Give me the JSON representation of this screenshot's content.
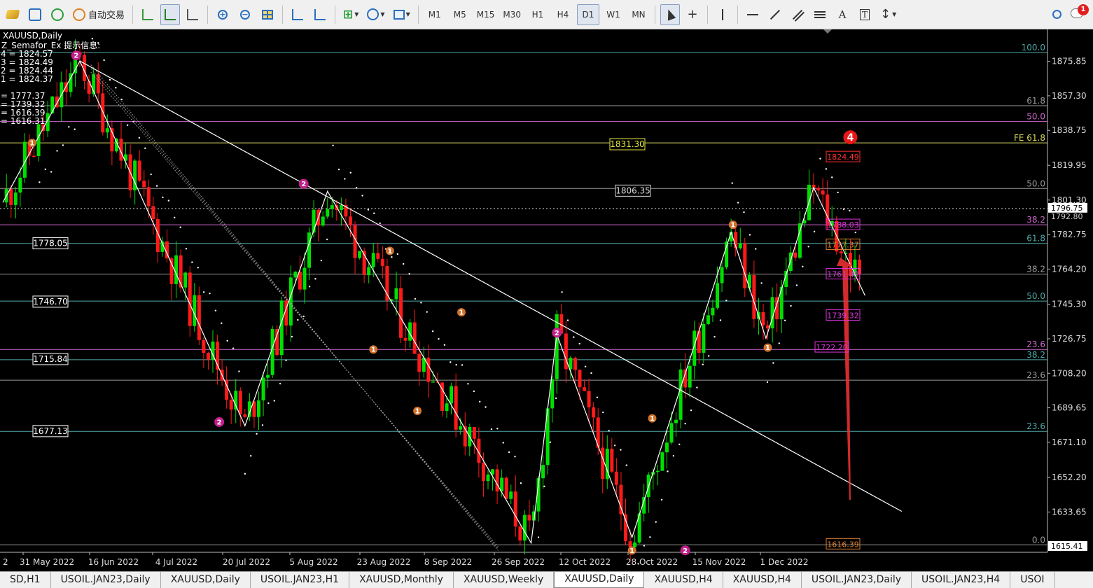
{
  "toolbar": {
    "auto_trading_label": "自动交易",
    "timeframes": [
      "M1",
      "M5",
      "M15",
      "M30",
      "H1",
      "H4",
      "D1",
      "W1",
      "MN"
    ],
    "active_timeframe": "D1",
    "text_tool": "A",
    "notification_count": "1"
  },
  "chart_info": {
    "symbol_period": "XAUUSD,Daily",
    "indicator_header": "Z_Semafor_Ex 提示信息:",
    "indicator_rows": [
      "4 = 1824.57",
      "3 = 1824.49",
      "2 = 1824.44",
      "1 = 1824.37",
      "= 1777.37",
      "= 1739.32",
      "= 1616.39",
      "= 1616.31"
    ]
  },
  "chart_data": {
    "type": "candlestick",
    "symbol": "XAUUSD",
    "period": "Daily",
    "price_axis_ticks": [
      1875.85,
      1857.3,
      1838.75,
      1819.95,
      1801.3,
      1782.75,
      1764.2,
      1745.3,
      1726.75,
      1708.2,
      1689.65,
      1671.1,
      1652.2,
      1633.65,
      1615.41
    ],
    "current_price_labels": [
      "1796.75",
      "1792.80"
    ],
    "bottom_price_label": "1615.41",
    "date_ticks": [
      "2",
      "31 May 2022",
      "16 Jun 2022",
      "4 Jul 2022",
      "20 Jul 2022",
      "5 Aug 2022",
      "23 Aug 2022",
      "8 Sep 2022",
      "26 Sep 2022",
      "12 Oct 2022",
      "28 Oct 2022",
      "15 Nov 2022",
      "1 Dec 2022"
    ],
    "fibo_levels": [
      {
        "label": "100.0",
        "price": 1880.5,
        "color": "#4fa8a8"
      },
      {
        "label": "61.8",
        "price": 1852.0,
        "color": "#9a9a9a"
      },
      {
        "label": "50.0",
        "price": 1843.5,
        "color": "#cc66cc"
      },
      {
        "label": "FE 61.8",
        "price": 1832.0,
        "color": "#d8d860"
      },
      {
        "label": "50.0",
        "price": 1807.5,
        "color": "#9a9a9a"
      },
      {
        "label": "38.2",
        "price": 1788.0,
        "color": "#cc66cc"
      },
      {
        "label": "61.8",
        "price": 1778.0,
        "color": "#4fa8a8"
      },
      {
        "label": "38.2",
        "price": 1761.5,
        "color": "#9a9a9a"
      },
      {
        "label": "50.0",
        "price": 1747.0,
        "color": "#4fa8a8"
      },
      {
        "label": "23.6",
        "price": 1721.0,
        "color": "#cc66cc"
      },
      {
        "label": "38.2",
        "price": 1715.5,
        "color": "#4fa8a8"
      },
      {
        "label": "23.6",
        "price": 1704.5,
        "color": "#9a9a9a"
      },
      {
        "label": "23.6",
        "price": 1677.0,
        "color": "#4fa8a8"
      },
      {
        "label": "0.0",
        "price": 1616.0,
        "color": "#9a9a9a"
      }
    ],
    "left_price_boxes": [
      {
        "text": "1778.05",
        "price": 1778.05
      },
      {
        "text": "1746.70",
        "price": 1746.7
      },
      {
        "text": "1715.84",
        "price": 1715.84
      },
      {
        "text": "1677.13",
        "price": 1677.13
      }
    ],
    "mid_price_boxes": [
      {
        "text": "1831.30",
        "price": 1831.3,
        "color": "#e8e840"
      },
      {
        "text": "1806.35",
        "price": 1806.35,
        "color": "#dddddd"
      }
    ],
    "right_price_boxes": [
      {
        "text": "1824.49",
        "price": 1824.49,
        "color": "#ff3030"
      },
      {
        "text": "1788.03",
        "price": 1788.03,
        "color": "#dd33dd"
      },
      {
        "text": "1777.37",
        "price": 1777.37,
        "color": "#e08030"
      },
      {
        "text": "1761.49",
        "price": 1761.49,
        "color": "#dd33dd"
      },
      {
        "text": "1739.32",
        "price": 1739.32,
        "color": "#dd33dd"
      },
      {
        "text": "1722.20",
        "price": 1722.2,
        "color": "#dd33dd"
      },
      {
        "text": "1616.39",
        "price": 1616.39,
        "color": "#e08030"
      }
    ],
    "semafor_signals": [
      {
        "label": "1",
        "day": 16,
        "price": 1832,
        "type": "orange"
      },
      {
        "label": "2",
        "day": 40,
        "price": 1879,
        "type": "magenta"
      },
      {
        "label": "2",
        "day": 118,
        "price": 1682,
        "type": "magenta"
      },
      {
        "label": "2",
        "day": 164,
        "price": 1810,
        "type": "magenta"
      },
      {
        "label": "1",
        "day": 202,
        "price": 1721,
        "type": "orange"
      },
      {
        "label": "1",
        "day": 211,
        "price": 1774,
        "type": "orange"
      },
      {
        "label": "1",
        "day": 226,
        "price": 1688,
        "type": "orange"
      },
      {
        "label": "1",
        "day": 250,
        "price": 1741,
        "type": "orange"
      },
      {
        "label": "2",
        "day": 302,
        "price": 1730,
        "type": "magenta"
      },
      {
        "label": "1",
        "day": 354,
        "price": 1684,
        "type": "orange"
      },
      {
        "label": "1",
        "day": 343,
        "price": 1613,
        "type": "orange"
      },
      {
        "label": "2",
        "day": 372,
        "price": 1613,
        "type": "magenta"
      },
      {
        "label": "1",
        "day": 398,
        "price": 1788,
        "type": "orange"
      },
      {
        "label": "1",
        "day": 417,
        "price": 1722,
        "type": "orange"
      },
      {
        "label": "4",
        "day": 462,
        "price": 1835,
        "type": "red"
      }
    ],
    "zigzag": [
      [
        0,
        1800
      ],
      [
        42,
        1876
      ],
      [
        132,
        1680
      ],
      [
        177,
        1806
      ],
      [
        288,
        1617
      ],
      [
        302,
        1729
      ],
      [
        343,
        1620
      ],
      [
        397,
        1784
      ],
      [
        416,
        1727
      ],
      [
        442,
        1808
      ],
      [
        470,
        1750
      ]
    ],
    "trendline": [
      [
        42,
        1876
      ],
      [
        490,
        1634
      ]
    ],
    "current_price": 1796.75,
    "ylim": [
      1612,
      1893
    ]
  },
  "tabs": [
    {
      "label": "SD,H1",
      "active": false
    },
    {
      "label": "USOIL.JAN23,Daily",
      "active": false
    },
    {
      "label": "XAUUSD,Daily",
      "active": false
    },
    {
      "label": "USOIL.JAN23,H1",
      "active": false
    },
    {
      "label": "XAUUSD,Monthly",
      "active": false
    },
    {
      "label": "XAUUSD,Weekly",
      "active": false
    },
    {
      "label": "XAUUSD,Daily",
      "active": true
    },
    {
      "label": "XAUUSD,H4",
      "active": false
    },
    {
      "label": "XAUUSD,H4",
      "active": false
    },
    {
      "label": "USOIL.JAN23,Daily",
      "active": false
    },
    {
      "label": "USOIL.JAN23,H4",
      "active": false
    },
    {
      "label": "USOI",
      "active": false
    }
  ],
  "colors": {
    "bull": "#00e000",
    "bear": "#ff1a1a",
    "background": "#000000",
    "zigzag": "#ffffff",
    "arrow": "#e83030"
  }
}
